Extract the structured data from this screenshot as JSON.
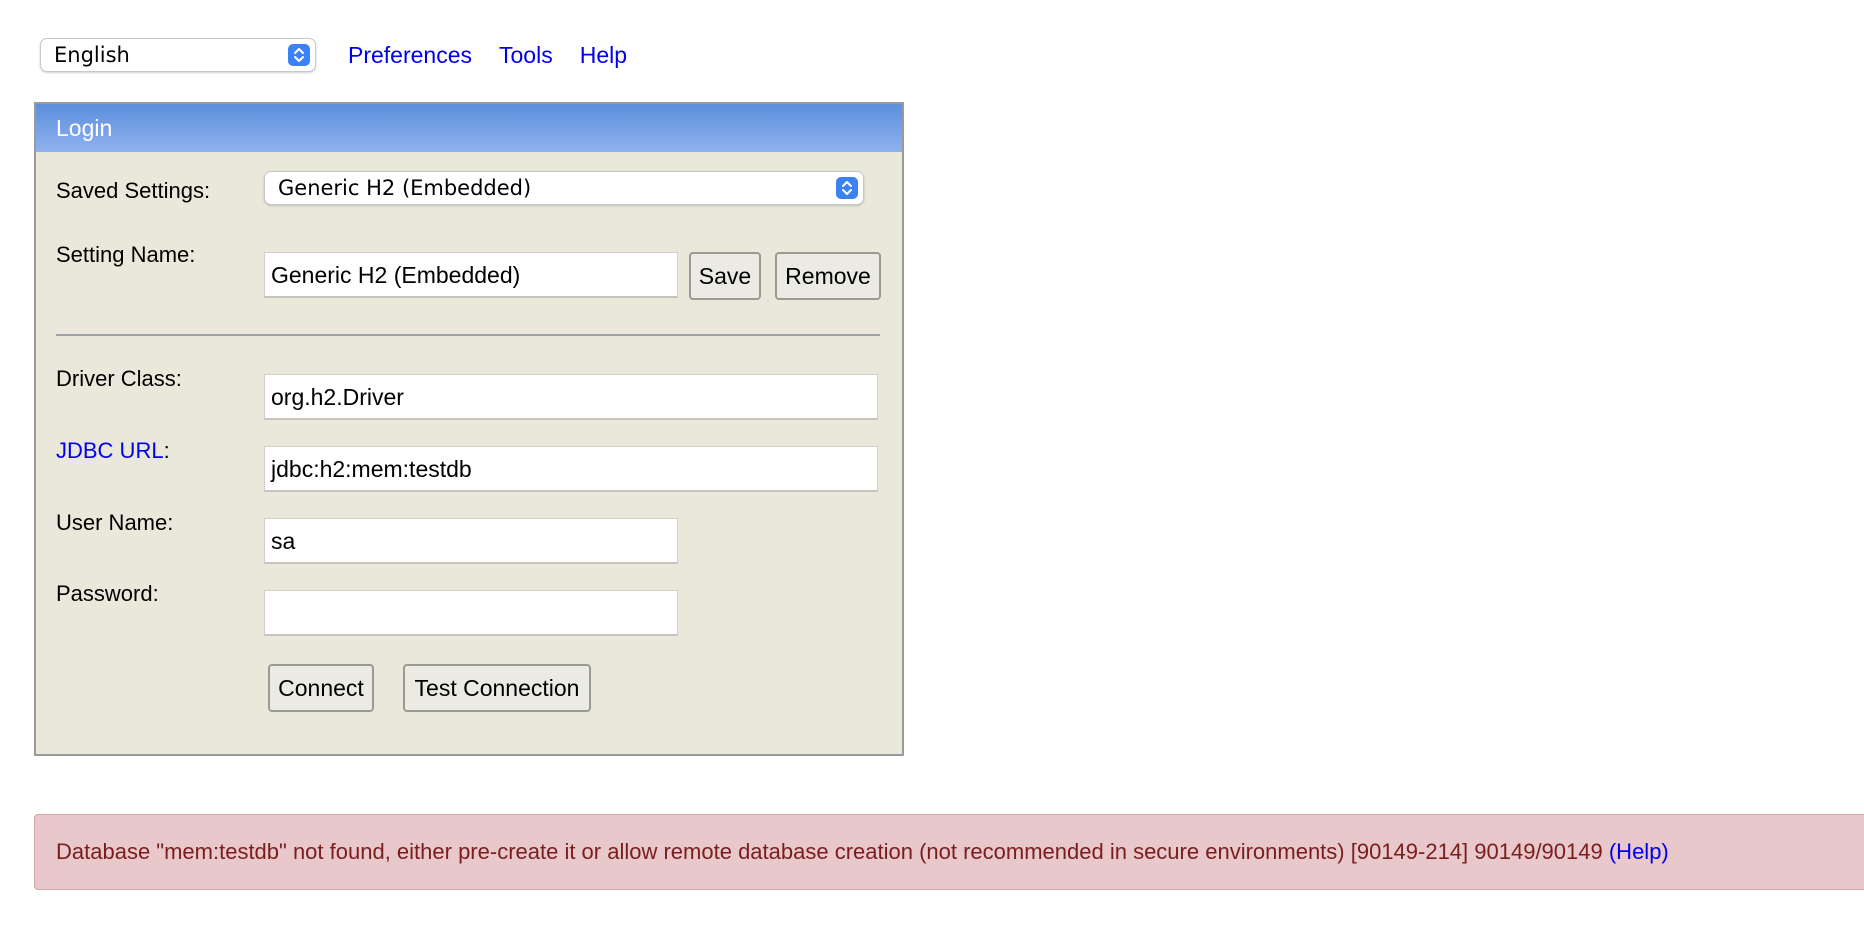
{
  "top": {
    "language": {
      "selected": "English"
    },
    "links": [
      {
        "label": "Preferences"
      },
      {
        "label": "Tools"
      },
      {
        "label": "Help"
      }
    ]
  },
  "login": {
    "header": "Login",
    "saved_settings": {
      "label": "Saved Settings:",
      "selected": "Generic H2 (Embedded)"
    },
    "setting_name": {
      "label": "Setting Name:",
      "value": "Generic H2 (Embedded)"
    },
    "save_label": "Save",
    "remove_label": "Remove",
    "driver_class": {
      "label": "Driver Class:",
      "value": "org.h2.Driver"
    },
    "jdbc_url": {
      "label": "JDBC URL",
      "suffix": ":",
      "value": "jdbc:h2:mem:testdb"
    },
    "user_name": {
      "label": "User Name:",
      "value": "sa"
    },
    "password": {
      "label": "Password:",
      "value": ""
    },
    "connect_label": "Connect",
    "test_connection_label": "Test Connection"
  },
  "error": {
    "message": "Database \"mem:testdb\" not found, either pre-create it or allow remote database creation (not recommended in secure environments) [90149-214] 90149/90149 ",
    "help_label": "(Help)"
  },
  "colors": {
    "link": "#0000ee",
    "header_gradient_top": "#5c8fdc",
    "panel_bg": "#eae8da",
    "error_bg": "#e8c8ca",
    "error_text": "#7a1d1d",
    "select_arrow": "#3b82f6"
  }
}
